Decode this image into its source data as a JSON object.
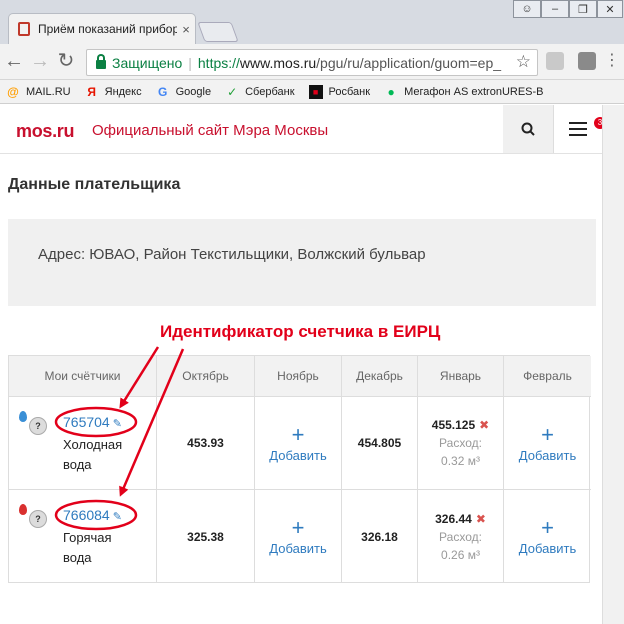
{
  "browser": {
    "tab_title": "Приём показаний прибор",
    "tab_close": "×",
    "secure_label": "Защищено",
    "url_scheme": "https://",
    "url_host": "www.mos.ru",
    "url_path": "/pgu/ru/application/guom=ep_",
    "bookmarks": [
      {
        "label": "MAIL.RU",
        "icon": "mail-icon",
        "color": "#ff9e00"
      },
      {
        "label": "Яндекс",
        "icon": "yandex-icon",
        "color": "#e61400"
      },
      {
        "label": "Google",
        "icon": "google-icon",
        "color": "#4285f4"
      },
      {
        "label": "Сбербанк",
        "icon": "sberbank-icon",
        "color": "#21a038"
      },
      {
        "label": "Росбанк",
        "icon": "rosbank-icon",
        "color": "#e2001a"
      },
      {
        "label": "Мегафон AS extronURES-B",
        "icon": "megafon-icon",
        "color": "#00b956"
      }
    ]
  },
  "site": {
    "logo": "mos.ru",
    "title": "Официальный сайт Мэра Москвы",
    "menu_badge": "3",
    "brand_color": "#c8102e"
  },
  "payer": {
    "heading": "Данные плательщика",
    "address": "Адрес: ЮВАО, Район Текстильщики, Волжский бульвар"
  },
  "annotation": {
    "text": "Идентификатор счетчика в ЕИРЦ",
    "color": "#e2001a"
  },
  "table": {
    "headers": [
      "Мои счётчики",
      "Октябрь",
      "Ноябрь",
      "Декабрь",
      "Январь",
      "Февраль"
    ],
    "add_label": "Добавить",
    "plus": "+",
    "consumption_label": "Расход:",
    "rows": [
      {
        "id": "765704",
        "name_line1": "Холодная",
        "name_line2": "вода",
        "drop_color": "#3a8fd6",
        "oct": "453.93",
        "dec": "454.805",
        "jan": "455.125",
        "jan_usage": "0.32 м³"
      },
      {
        "id": "766084",
        "name_line1": "Горячая",
        "name_line2": "вода",
        "drop_color": "#d9302f",
        "oct": "325.38",
        "dec": "326.18",
        "jan": "326.44",
        "jan_usage": "0.26 м³"
      }
    ]
  }
}
